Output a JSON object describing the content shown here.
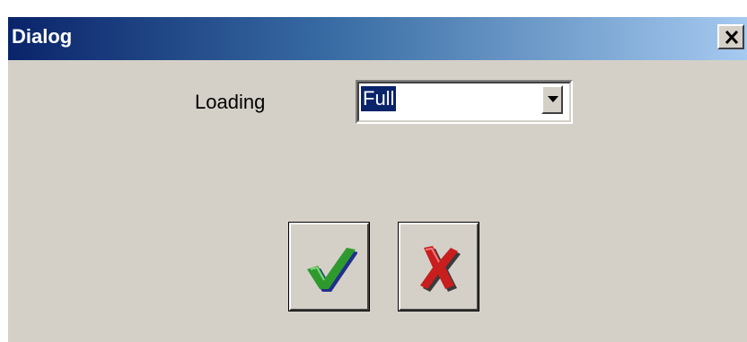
{
  "window": {
    "title": "Dialog"
  },
  "form": {
    "loading_label": "Loading",
    "loading_value": "Full"
  },
  "buttons": {
    "ok_icon": "checkmark-icon",
    "cancel_icon": "x-icon"
  },
  "colors": {
    "titlebar_start": "#0a246a",
    "titlebar_end": "#a6caf0",
    "face": "#d4d0c8",
    "ok_green": "#2e9a2e",
    "cancel_red": "#c81e1e"
  }
}
